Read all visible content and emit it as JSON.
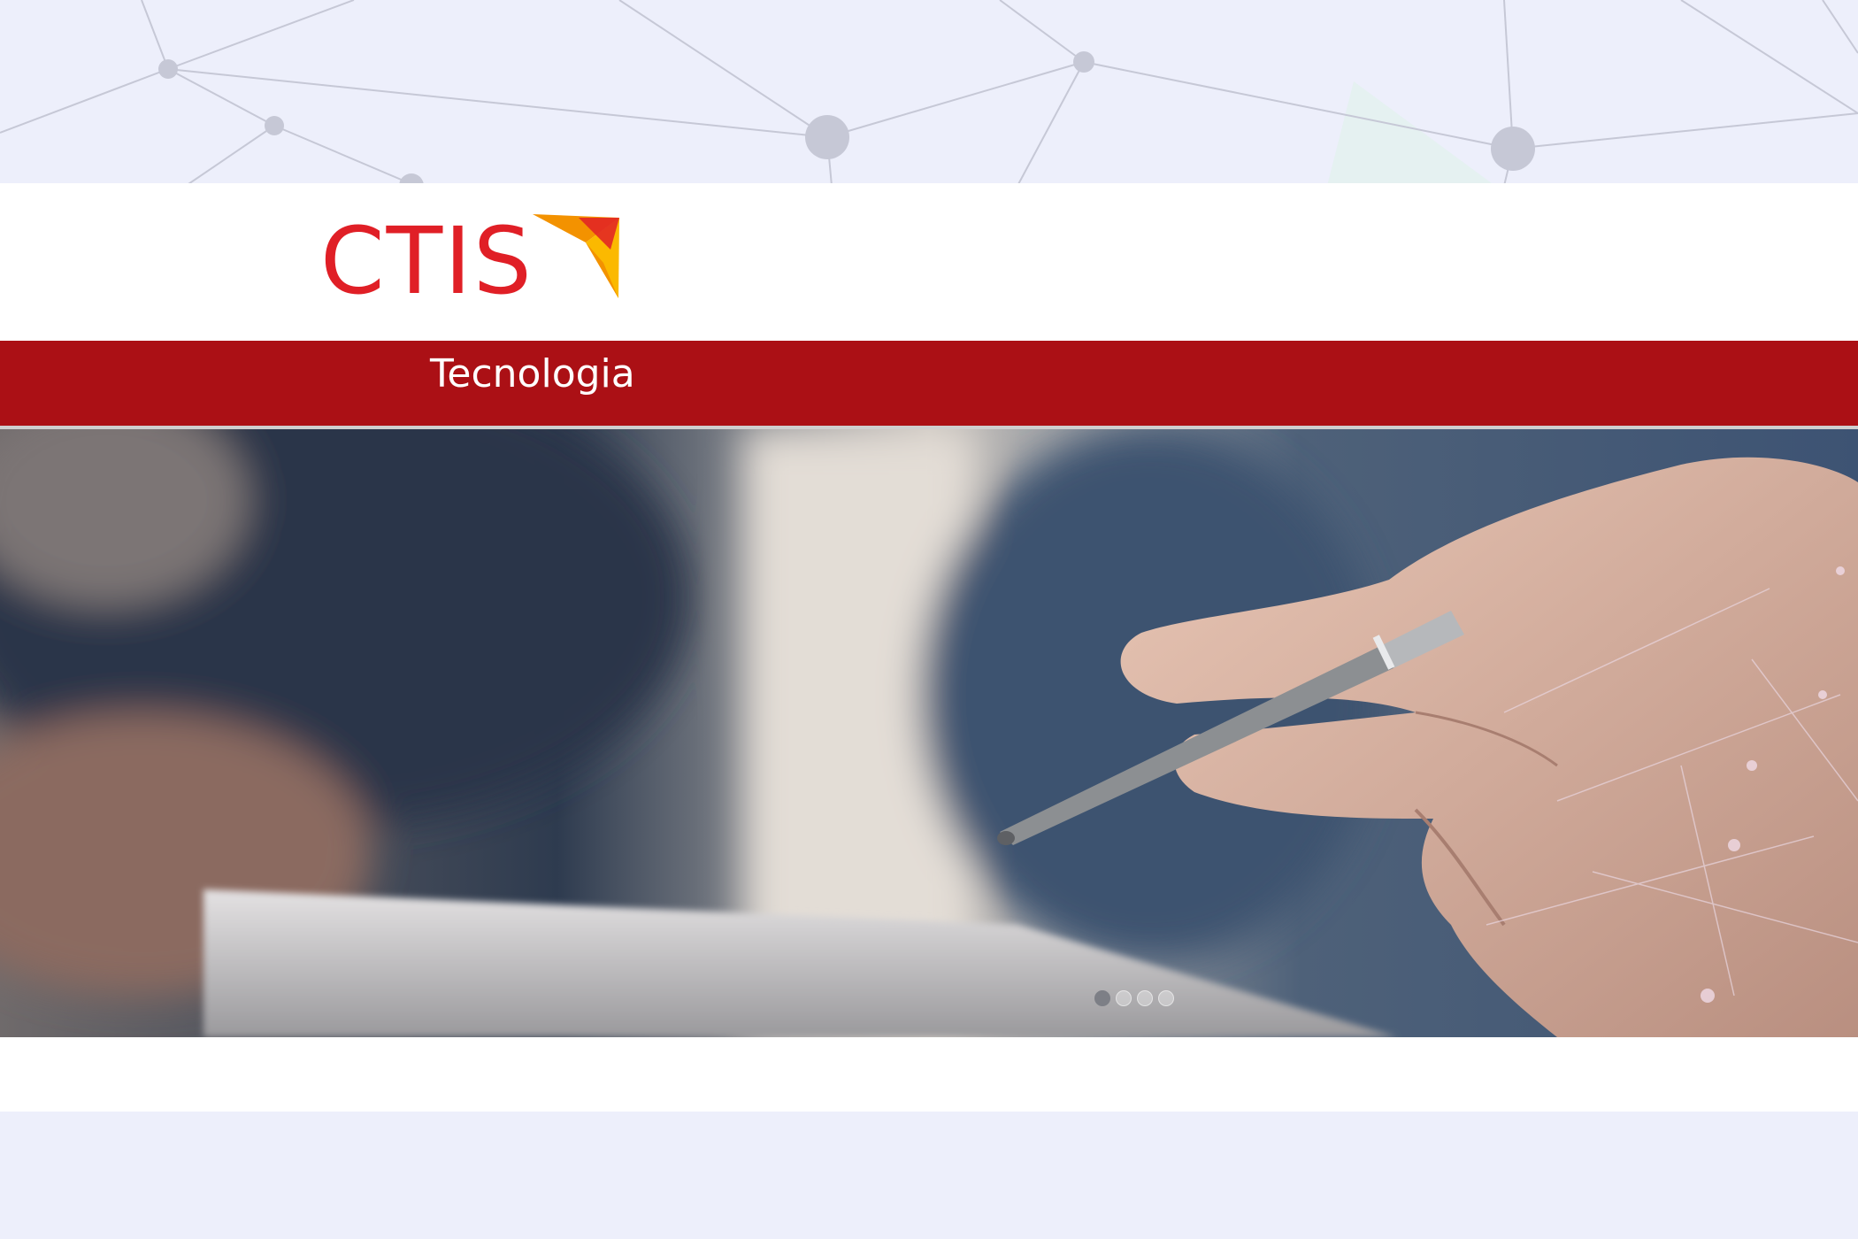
{
  "brand": {
    "logo_text": "CTIS",
    "logo_color": "#e01f26",
    "accent_colors": [
      "#f39200",
      "#fbb900",
      "#e01f26"
    ]
  },
  "banner": {
    "label": "Tecnologia",
    "color": "#ab1015"
  },
  "hero": {
    "image_icon": "hand-holding-pen-image"
  },
  "carousel": {
    "slides": 4,
    "active_slide": 1
  },
  "colors": {
    "page_background": "#edeffb",
    "header_background": "#ffffff"
  }
}
